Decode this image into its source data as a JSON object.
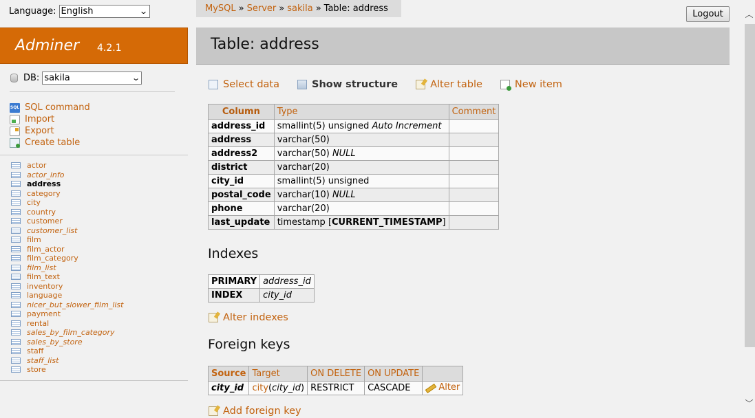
{
  "language": {
    "label": "Language:",
    "value": "English"
  },
  "brand": {
    "name": "Adminer",
    "version": "4.2.1"
  },
  "db": {
    "label": "DB:",
    "value": "sakila"
  },
  "commands": [
    {
      "label": "SQL command",
      "icon": "sql-icon"
    },
    {
      "label": "Import",
      "icon": "import-icon"
    },
    {
      "label": "Export",
      "icon": "export-icon"
    },
    {
      "label": "Create table",
      "icon": "create-table-icon"
    }
  ],
  "tables": [
    {
      "name": "actor",
      "view": false,
      "current": false
    },
    {
      "name": "actor_info",
      "view": true,
      "current": false
    },
    {
      "name": "address",
      "view": false,
      "current": true
    },
    {
      "name": "category",
      "view": false,
      "current": false
    },
    {
      "name": "city",
      "view": false,
      "current": false
    },
    {
      "name": "country",
      "view": false,
      "current": false
    },
    {
      "name": "customer",
      "view": false,
      "current": false
    },
    {
      "name": "customer_list",
      "view": true,
      "current": false
    },
    {
      "name": "film",
      "view": false,
      "current": false
    },
    {
      "name": "film_actor",
      "view": false,
      "current": false
    },
    {
      "name": "film_category",
      "view": false,
      "current": false
    },
    {
      "name": "film_list",
      "view": true,
      "current": false
    },
    {
      "name": "film_text",
      "view": false,
      "current": false
    },
    {
      "name": "inventory",
      "view": false,
      "current": false
    },
    {
      "name": "language",
      "view": false,
      "current": false
    },
    {
      "name": "nicer_but_slower_film_list",
      "view": true,
      "current": false
    },
    {
      "name": "payment",
      "view": false,
      "current": false
    },
    {
      "name": "rental",
      "view": false,
      "current": false
    },
    {
      "name": "sales_by_film_category",
      "view": true,
      "current": false
    },
    {
      "name": "sales_by_store",
      "view": true,
      "current": false
    },
    {
      "name": "staff",
      "view": false,
      "current": false
    },
    {
      "name": "staff_list",
      "view": true,
      "current": false
    },
    {
      "name": "store",
      "view": false,
      "current": false
    }
  ],
  "breadcrumb": {
    "mysql": "MySQL",
    "server": "Server",
    "db": "sakila",
    "sep": "»",
    "current": "Table: address"
  },
  "logout_label": "Logout",
  "title": "Table: address",
  "actions": {
    "select_data": "Select data",
    "show_structure": "Show structure",
    "alter_table": "Alter table",
    "new_item": "New item"
  },
  "structure": {
    "headers": {
      "column": "Column",
      "type": "Type",
      "comment": "Comment"
    },
    "rows": [
      {
        "column": "address_id",
        "type": "smallint(5) unsigned",
        "extra": "Auto Increment",
        "comment": ""
      },
      {
        "column": "address",
        "type": "varchar(50)",
        "extra": "",
        "comment": ""
      },
      {
        "column": "address2",
        "type": "varchar(50)",
        "extra": "NULL",
        "comment": ""
      },
      {
        "column": "district",
        "type": "varchar(20)",
        "extra": "",
        "comment": ""
      },
      {
        "column": "city_id",
        "type": "smallint(5) unsigned",
        "extra": "",
        "comment": ""
      },
      {
        "column": "postal_code",
        "type": "varchar(10)",
        "extra": "NULL",
        "comment": ""
      },
      {
        "column": "phone",
        "type": "varchar(20)",
        "extra": "",
        "comment": ""
      },
      {
        "column": "last_update",
        "type": "timestamp [",
        "default": "CURRENT_TIMESTAMP",
        "type_end": "]",
        "extra": "",
        "comment": ""
      }
    ]
  },
  "indexes": {
    "heading": "Indexes",
    "rows": [
      {
        "type": "PRIMARY",
        "columns": "address_id"
      },
      {
        "type": "INDEX",
        "columns": "city_id"
      }
    ],
    "alter_label": "Alter indexes"
  },
  "foreign_keys": {
    "heading": "Foreign keys",
    "headers": {
      "source": "Source",
      "target": "Target",
      "on_delete": "ON DELETE",
      "on_update": "ON UPDATE"
    },
    "rows": [
      {
        "source": "city_id",
        "target_table": "city",
        "target_column": "city_id",
        "on_delete": "RESTRICT",
        "on_update": "CASCADE",
        "alter": "Alter"
      }
    ],
    "add_label": "Add foreign key"
  }
}
